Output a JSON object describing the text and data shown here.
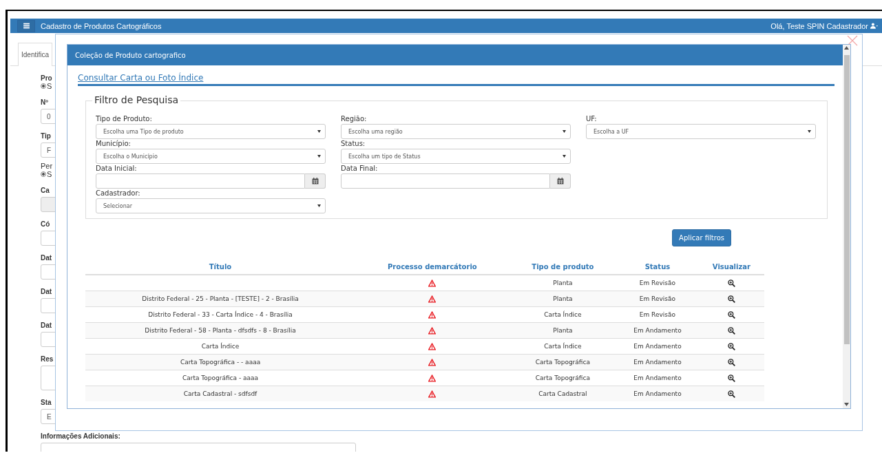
{
  "page": {
    "header": {
      "title": "Cadastro de Produtos Cartográficos",
      "user": "Olá, Teste SPIN Cadastrador"
    },
    "tab": {
      "label": "Identifica",
      "selected": true
    },
    "form": [
      {
        "kind": "label",
        "text": "Pro"
      },
      {
        "kind": "radio",
        "text": "S",
        "checked": true
      },
      {
        "kind": "label",
        "text": "Nº"
      },
      {
        "kind": "input",
        "text": "0"
      },
      {
        "kind": "label",
        "text": "Tip"
      },
      {
        "kind": "input",
        "text": "F"
      },
      {
        "kind": "note",
        "text": "Per"
      },
      {
        "kind": "radio",
        "text": "S",
        "checked": true
      },
      {
        "kind": "label",
        "text": "Ca"
      },
      {
        "kind": "grayinput"
      },
      {
        "kind": "label",
        "text": "Có"
      },
      {
        "kind": "input"
      },
      {
        "kind": "label",
        "text": "Dat"
      },
      {
        "kind": "input"
      },
      {
        "kind": "label",
        "text": "Dat"
      },
      {
        "kind": "input"
      },
      {
        "kind": "label",
        "text": "Dat"
      },
      {
        "kind": "input"
      },
      {
        "kind": "label",
        "text": "Res"
      },
      {
        "kind": "textarea"
      },
      {
        "kind": "label",
        "text": "Sta"
      },
      {
        "kind": "input",
        "text": "E"
      },
      {
        "kind": "label",
        "text": "Informações Adicionais:"
      },
      {
        "kind": "wide"
      }
    ]
  },
  "modal": {
    "title": "Coleção de Produto cartografico",
    "link": "Consultar Carta ou Foto Índice",
    "filter": {
      "legend": "Filtro de Pesquisa",
      "rows": [
        [
          {
            "kind": "select",
            "label": "Tipo de Produto:",
            "value": "Escolha uma Tipo de produto"
          },
          {
            "kind": "select",
            "label": "Região:",
            "value": "Escolha uma região"
          },
          {
            "kind": "select",
            "label": "UF:",
            "value": "Escolha a UF"
          }
        ],
        [
          {
            "kind": "select",
            "label": "Município:",
            "value": "Escolha o Município"
          },
          {
            "kind": "select",
            "label": "Status:",
            "value": "Escolha um tipo de Status"
          }
        ],
        [
          {
            "kind": "date",
            "label": "Data Inicial:"
          },
          {
            "kind": "date",
            "label": "Data Final:"
          }
        ],
        [
          {
            "kind": "select",
            "label": "Cadastrador:",
            "value": "Selecionar"
          }
        ]
      ],
      "apply": "Aplicar filtros"
    },
    "table": {
      "columns": [
        "Título",
        "Processo demarcátorio",
        "Tipo de produto",
        "Status",
        "Visualizar"
      ],
      "rows": [
        {
          "title": "",
          "type": "Planta",
          "status": "Em Revisão"
        },
        {
          "title": "Distrito Federal - 25 - Planta - [TESTE] - 2 - Brasília",
          "type": "Planta",
          "status": "Em Revisão"
        },
        {
          "title": "Distrito Federal - 33 - Carta Índice - 4 - Brasília",
          "type": "Carta Índice",
          "status": "Em Revisão"
        },
        {
          "title": "Distrito Federal - 58 - Planta - dfsdfs - 8 - Brasília",
          "type": "Planta",
          "status": "Em Andamento"
        },
        {
          "title": "Carta Índice",
          "type": "Carta Índice",
          "status": "Em Andamento"
        },
        {
          "title": "Carta Topográfica - - aaaa",
          "type": "Carta Topográfica",
          "status": "Em Andamento"
        },
        {
          "title": "Carta Topográfica - aaaa",
          "type": "Carta Topográfica",
          "status": "Em Andamento"
        },
        {
          "title": "Carta Cadastral - sdfsdf",
          "type": "Carta Cadastral",
          "status": "Em Andamento"
        }
      ]
    }
  }
}
